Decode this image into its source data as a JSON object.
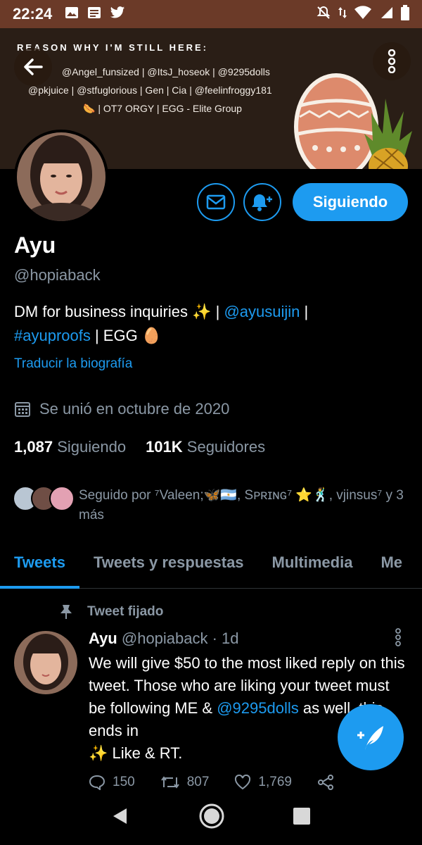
{
  "status_bar": {
    "time": "22:24",
    "left_icons": [
      "image-icon",
      "news-icon",
      "twitter-bird-icon"
    ],
    "right_icons": [
      "mute-icon",
      "data-arrows-icon",
      "wifi-icon",
      "signal-icon",
      "battery-icon"
    ]
  },
  "banner": {
    "heading": "REASON WHY I'M STILL HERE:",
    "line1": "@Angel_funsized | @ItsJ_hoseok | @9295dolls",
    "line2": "@pkjuice | @stfuglorious | Gen | Cia | @feelinfroggy181",
    "line3": "🌭 | OT7 ORGY | EGG - Elite Group"
  },
  "profile": {
    "name": "Ayu",
    "handle": "@hopiaback",
    "bio_part1": "DM for business inquiries ✨ | ",
    "bio_link1": "@ayusuijin",
    "bio_part2": " |",
    "bio_link2": "#ayuproofs",
    "bio_part3": " | EGG 🥚",
    "translate": "Traducir la biografía",
    "joined": "Se unió en octubre de 2020",
    "following_count": "1,087",
    "following_label": "Siguiendo",
    "followers_count": "101K",
    "followers_label": "Seguidores",
    "followed_by": "Seguido por ⁷Valeen;🦋🇦🇷, Sᴘʀɪɴɢ⁷ ⭐🕺, vjinsus⁷ y 3 más",
    "follow_button": "Siguiendo"
  },
  "tabs": [
    "Tweets",
    "Tweets y respuestas",
    "Multimedia",
    "Me"
  ],
  "tweet": {
    "pinned_label": "Tweet fijado",
    "name": "Ayu",
    "handle_time": "@hopiaback · 1d",
    "text_part1": "We will give $50 to the most liked reply on this tweet. Those who are liking your tweet must be following ME & ",
    "text_link": "@9295dolls",
    "text_part2": " as well. this ends in",
    "text_part3": "✨ Like & RT.",
    "replies": "150",
    "retweets": "807",
    "likes": "1,769"
  },
  "colors": {
    "accent": "#1d9bf0",
    "status_bar": "#6b3a28",
    "banner": "#2a1e16",
    "muted_text": "#8b98a5"
  }
}
